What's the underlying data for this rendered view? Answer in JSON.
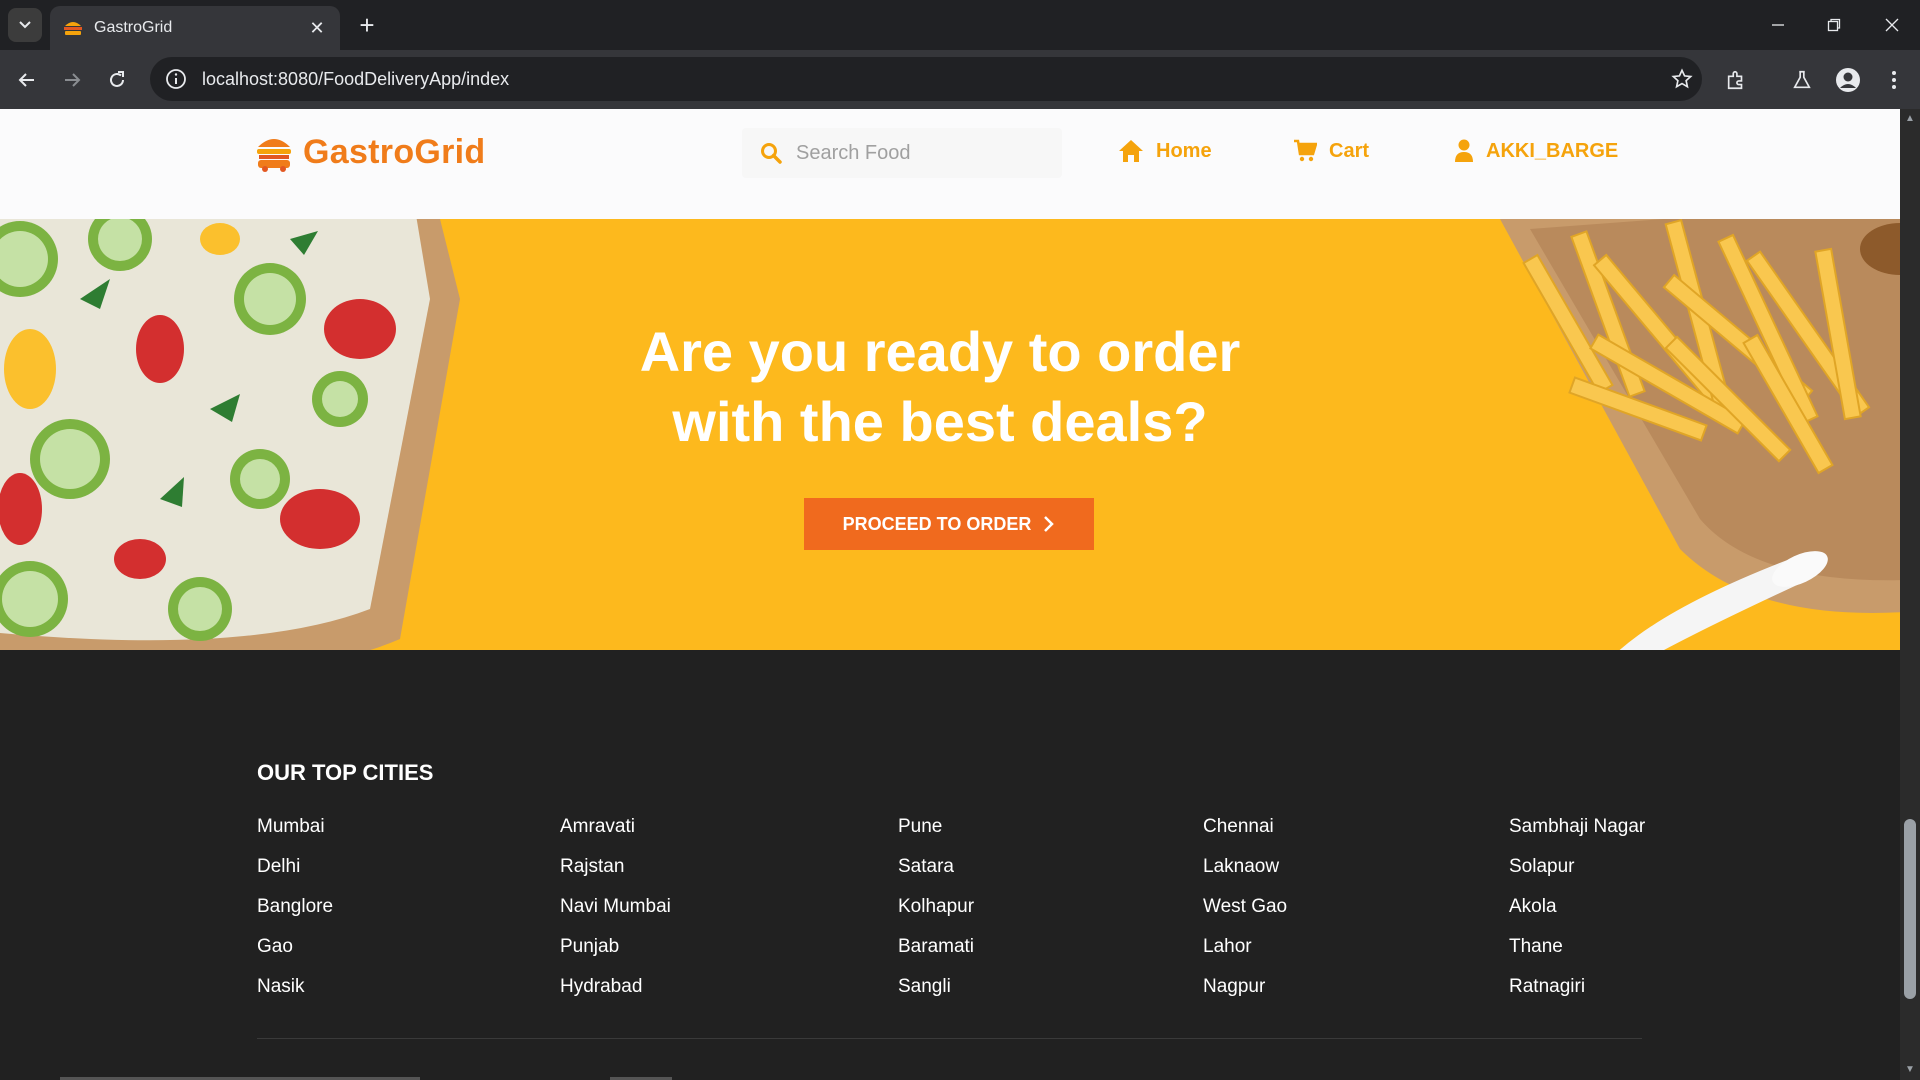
{
  "browser": {
    "tab_title": "GastroGrid",
    "url": "localhost:8080/FoodDeliveryApp/index"
  },
  "header": {
    "brand": "GastroGrid",
    "search_placeholder": "Search Food",
    "nav": {
      "home": "Home",
      "cart": "Cart",
      "user": "AKKI_BARGE"
    }
  },
  "hero": {
    "title_line1": "Are you ready to order",
    "title_line2": "with the best deals?",
    "cta_label": "PROCEED TO ORDER"
  },
  "footer": {
    "heading": "OUR TOP CITIES",
    "columns": [
      [
        "Mumbai",
        "Delhi",
        "Banglore",
        "Gao",
        "Nasik"
      ],
      [
        "Amravati",
        "Rajstan",
        "Navi Mumbai",
        "Punjab",
        "Hydrabad"
      ],
      [
        "Pune",
        "Satara",
        "Kolhapur",
        "Baramati",
        "Sangli"
      ],
      [
        "Chennai",
        "Laknaow",
        "West Gao",
        "Lahor",
        "Nagpur"
      ],
      [
        "Sambhaji Nagar",
        "Solapur",
        "Akola",
        "Thane",
        "Ratnagiri"
      ]
    ]
  },
  "colors": {
    "brand_orange": "#f07c1a",
    "nav_gold": "#f5a30c",
    "hero_yellow": "#fdb91d",
    "cta_orange": "#f06a1e",
    "footer_bg": "#212121"
  }
}
